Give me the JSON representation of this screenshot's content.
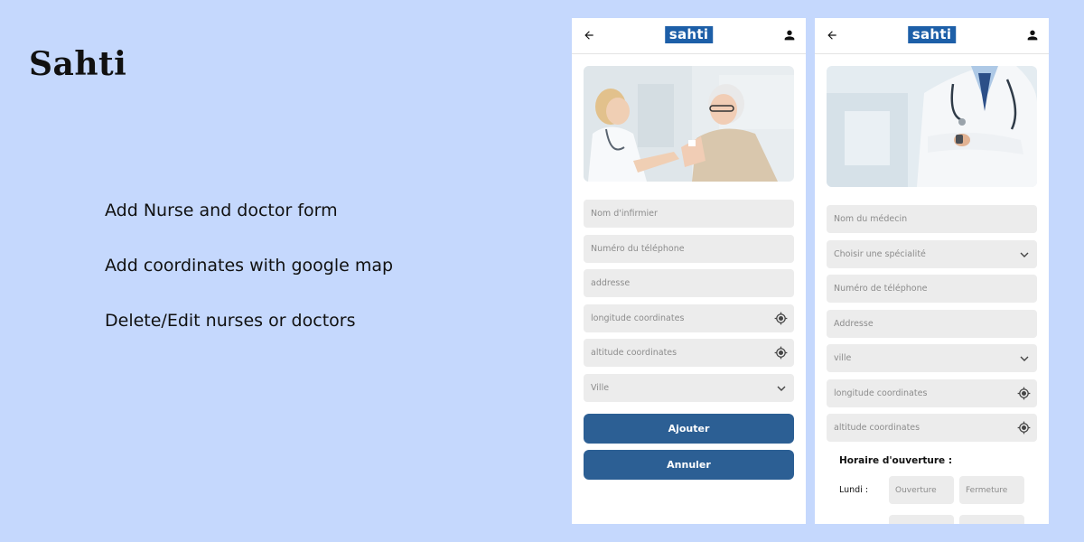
{
  "app": {
    "title": "Sahti"
  },
  "features": [
    "Add Nurse and doctor form",
    "Add coordinates with google map",
    "Delete/Edit nurses or doctors"
  ],
  "logo": "sahti",
  "nurse_form": {
    "fields": [
      {
        "placeholder": "Nom d'infirmier",
        "icon": ""
      },
      {
        "placeholder": "Numéro du téléphone",
        "icon": ""
      },
      {
        "placeholder": "addresse",
        "icon": ""
      },
      {
        "placeholder": "longitude coordinates",
        "icon": "location-target-icon"
      },
      {
        "placeholder": "altitude coordinates",
        "icon": "location-target-icon"
      },
      {
        "placeholder": "Ville",
        "icon": "chevron-down-icon"
      }
    ],
    "add_label": "Ajouter",
    "cancel_label": "Annuler"
  },
  "doctor_form": {
    "fields": [
      {
        "placeholder": "Nom du médecin",
        "icon": ""
      },
      {
        "placeholder": "Choisir une spécialité",
        "icon": "chevron-down-icon"
      },
      {
        "placeholder": "Numéro de téléphone",
        "icon": ""
      },
      {
        "placeholder": "Addresse",
        "icon": ""
      },
      {
        "placeholder": "ville",
        "icon": "chevron-down-icon"
      },
      {
        "placeholder": "longitude coordinates",
        "icon": "location-target-icon"
      },
      {
        "placeholder": "altitude coordinates",
        "icon": "location-target-icon"
      }
    ],
    "hours_title": "Horaire d'ouverture :",
    "day": "Lundi :",
    "open_placeholder": "Ouverture",
    "close_placeholder": "Fermeture"
  },
  "colors": {
    "background": "#c5d8fd",
    "brand": "#1d5fa8",
    "button": "#2c5f94",
    "field": "#ececec"
  }
}
